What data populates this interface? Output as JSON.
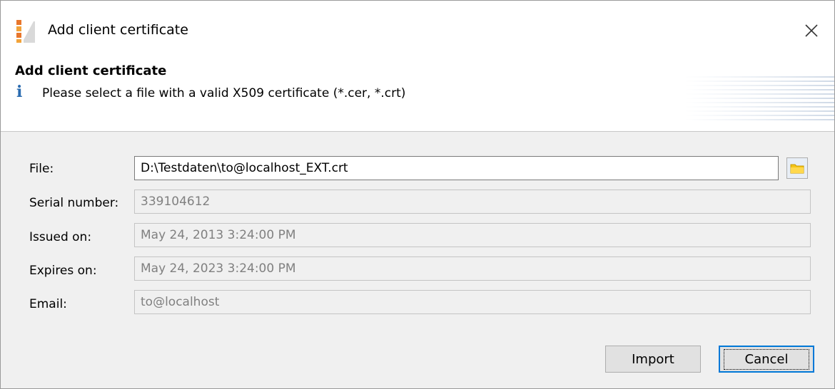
{
  "window": {
    "title": "Add client certificate"
  },
  "header": {
    "title": "Add client certificate",
    "message": "Please select a file with a valid X509 certificate (*.cer, *.crt)",
    "info_icon": "info-icon"
  },
  "form": {
    "file": {
      "label": "File:",
      "value": "D:\\Testdaten\\to@localhost_EXT.crt",
      "browse_icon": "folder-icon"
    },
    "serial": {
      "label": "Serial number:",
      "value": "339104612"
    },
    "issued": {
      "label": "Issued on:",
      "value": "May 24, 2013 3:24:00 PM"
    },
    "expires": {
      "label": "Expires on:",
      "value": "May 24, 2023 3:24:00 PM"
    },
    "email": {
      "label": "Email:",
      "value": "to@localhost"
    }
  },
  "buttons": {
    "import_label": "Import",
    "cancel_label": "Cancel"
  },
  "colors": {
    "accent": "#0078d7",
    "info": "#2b6cb0",
    "folder": "#f5c518"
  }
}
